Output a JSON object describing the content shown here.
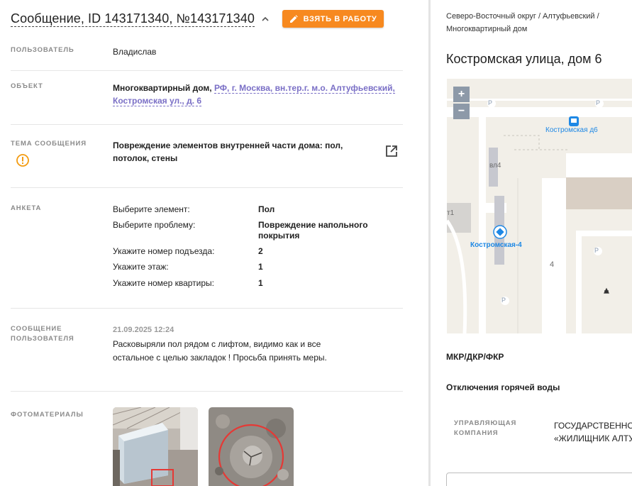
{
  "header": {
    "title": "Сообщение, ID 143171340, №143171340",
    "take_button": "ВЗЯТЬ В РАБОТУ"
  },
  "user": {
    "label": "ПОЛЬЗОВАТЕЛЬ",
    "value": "Владислав"
  },
  "object": {
    "label": "ОБЪЕКТ",
    "type": "Многоквартирный дом,",
    "address_line1": "РФ, г. Москва, вн.тер.г. м.о. Алтуфьевский,",
    "address_line2": "Костромская ул., д. 6"
  },
  "topic": {
    "label": "ТЕМА СООБЩЕНИЯ",
    "line1": "Повреждение элементов внутренней части дома: пол,",
    "line2": "потолок, стены"
  },
  "survey": {
    "label": "АНКЕТА",
    "rows": [
      {
        "q": "Выберите элемент:",
        "a": "Пол"
      },
      {
        "q": "Выберите проблему:",
        "a": "Повреждение напольного покрытия"
      },
      {
        "q": "Укажите номер подъезда:",
        "a": "2"
      },
      {
        "q": "Укажите этаж:",
        "a": "1"
      },
      {
        "q": "Укажите номер квартиры:",
        "a": "1"
      }
    ]
  },
  "user_message": {
    "label_line1": "СООБЩЕНИЕ",
    "label_line2": "ПОЛЬЗОВАТЕЛЯ",
    "date": "21.09.2025 12:24",
    "text": "Расковыряли пол рядом с лифтом, видимо как и все остальное с целью закладок ! Просьба принять меры."
  },
  "photos": {
    "label": "ФОТОМАТЕРИАЛЫ"
  },
  "right": {
    "breadcrumb_line1": "Северо-Восточный округ / Алтуфьевский /",
    "breadcrumb_line2": "Многоквартирный дом",
    "address_title": "Костромская улица, дом 6",
    "map": {
      "zoom_in": "+",
      "zoom_out": "−",
      "label_stop": "Костромская д6",
      "label_building": "Костромская-4",
      "label_vl4": "вл4",
      "label_t1": "т1",
      "label_4": "4",
      "label_p": "P"
    },
    "mkr": "МКР/ДКР/ФКР",
    "hot_water": "Отключения горячей воды",
    "mc_label_line1": "УПРАВЛЯЮЩАЯ",
    "mc_label_line2": "КОМПАНИЯ",
    "mc_value_line1": "ГОСУДАРСТВЕННОЕ",
    "mc_value_line2": "«ЖИЛИЩНИК АЛТУФ"
  },
  "colors": {
    "accent_orange": "#f7891f",
    "link_purple": "#7a6fc6",
    "warning_orange": "#f39c12",
    "map_blue": "#1e88e5"
  }
}
